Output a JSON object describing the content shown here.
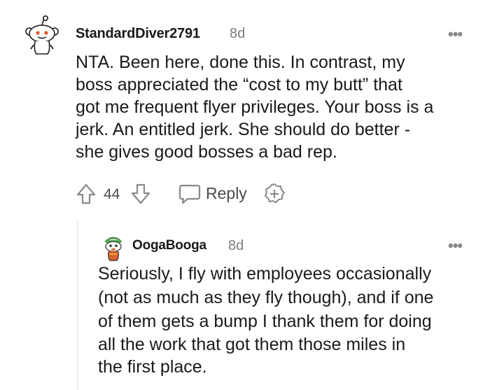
{
  "comment": {
    "username": "StandardDiver2791",
    "age": "8d",
    "more": "•••",
    "body": "NTA. Been here, done this. In contrast, my boss appreciated the “cost to my butt” that got me frequent flyer privileges. Your boss is a jerk. An entitled jerk. She should do better - she gives good bosses a bad rep.",
    "body_lines": [
      "NTA. Been here, done this. In contrast, my",
      "boss appreciated the “cost to my butt” that",
      "got me frequent flyer privileges. Your boss is a",
      "jerk. An entitled jerk. She should do better -",
      "she gives good bosses a bad rep."
    ],
    "votes": "44",
    "reply_label": "Reply",
    "icons": [
      "snoo-avatar-icon",
      "upvote-icon",
      "downvote-icon",
      "reply-bubble-icon",
      "award-plus-icon",
      "more-options-icon"
    ]
  },
  "reply": {
    "username": "OogaBooga",
    "age": "8d",
    "more": "•••",
    "body_lines": [
      "Seriously, I fly with employees occasionally",
      "(not as much as they fly though), and if one",
      "of them gets a bump I thank them for doing",
      "all the work that got them those miles in",
      "the first place."
    ],
    "icons": [
      "custom-snoo-avatar-icon",
      "more-options-icon"
    ]
  },
  "colors": {
    "text": "#1a1a1b",
    "meta": "#7c7c7c",
    "icon": "#878a8c",
    "thread_line": "#edeff1",
    "avatar_green": "#5cb85c",
    "avatar_orange": "#d9622b"
  }
}
